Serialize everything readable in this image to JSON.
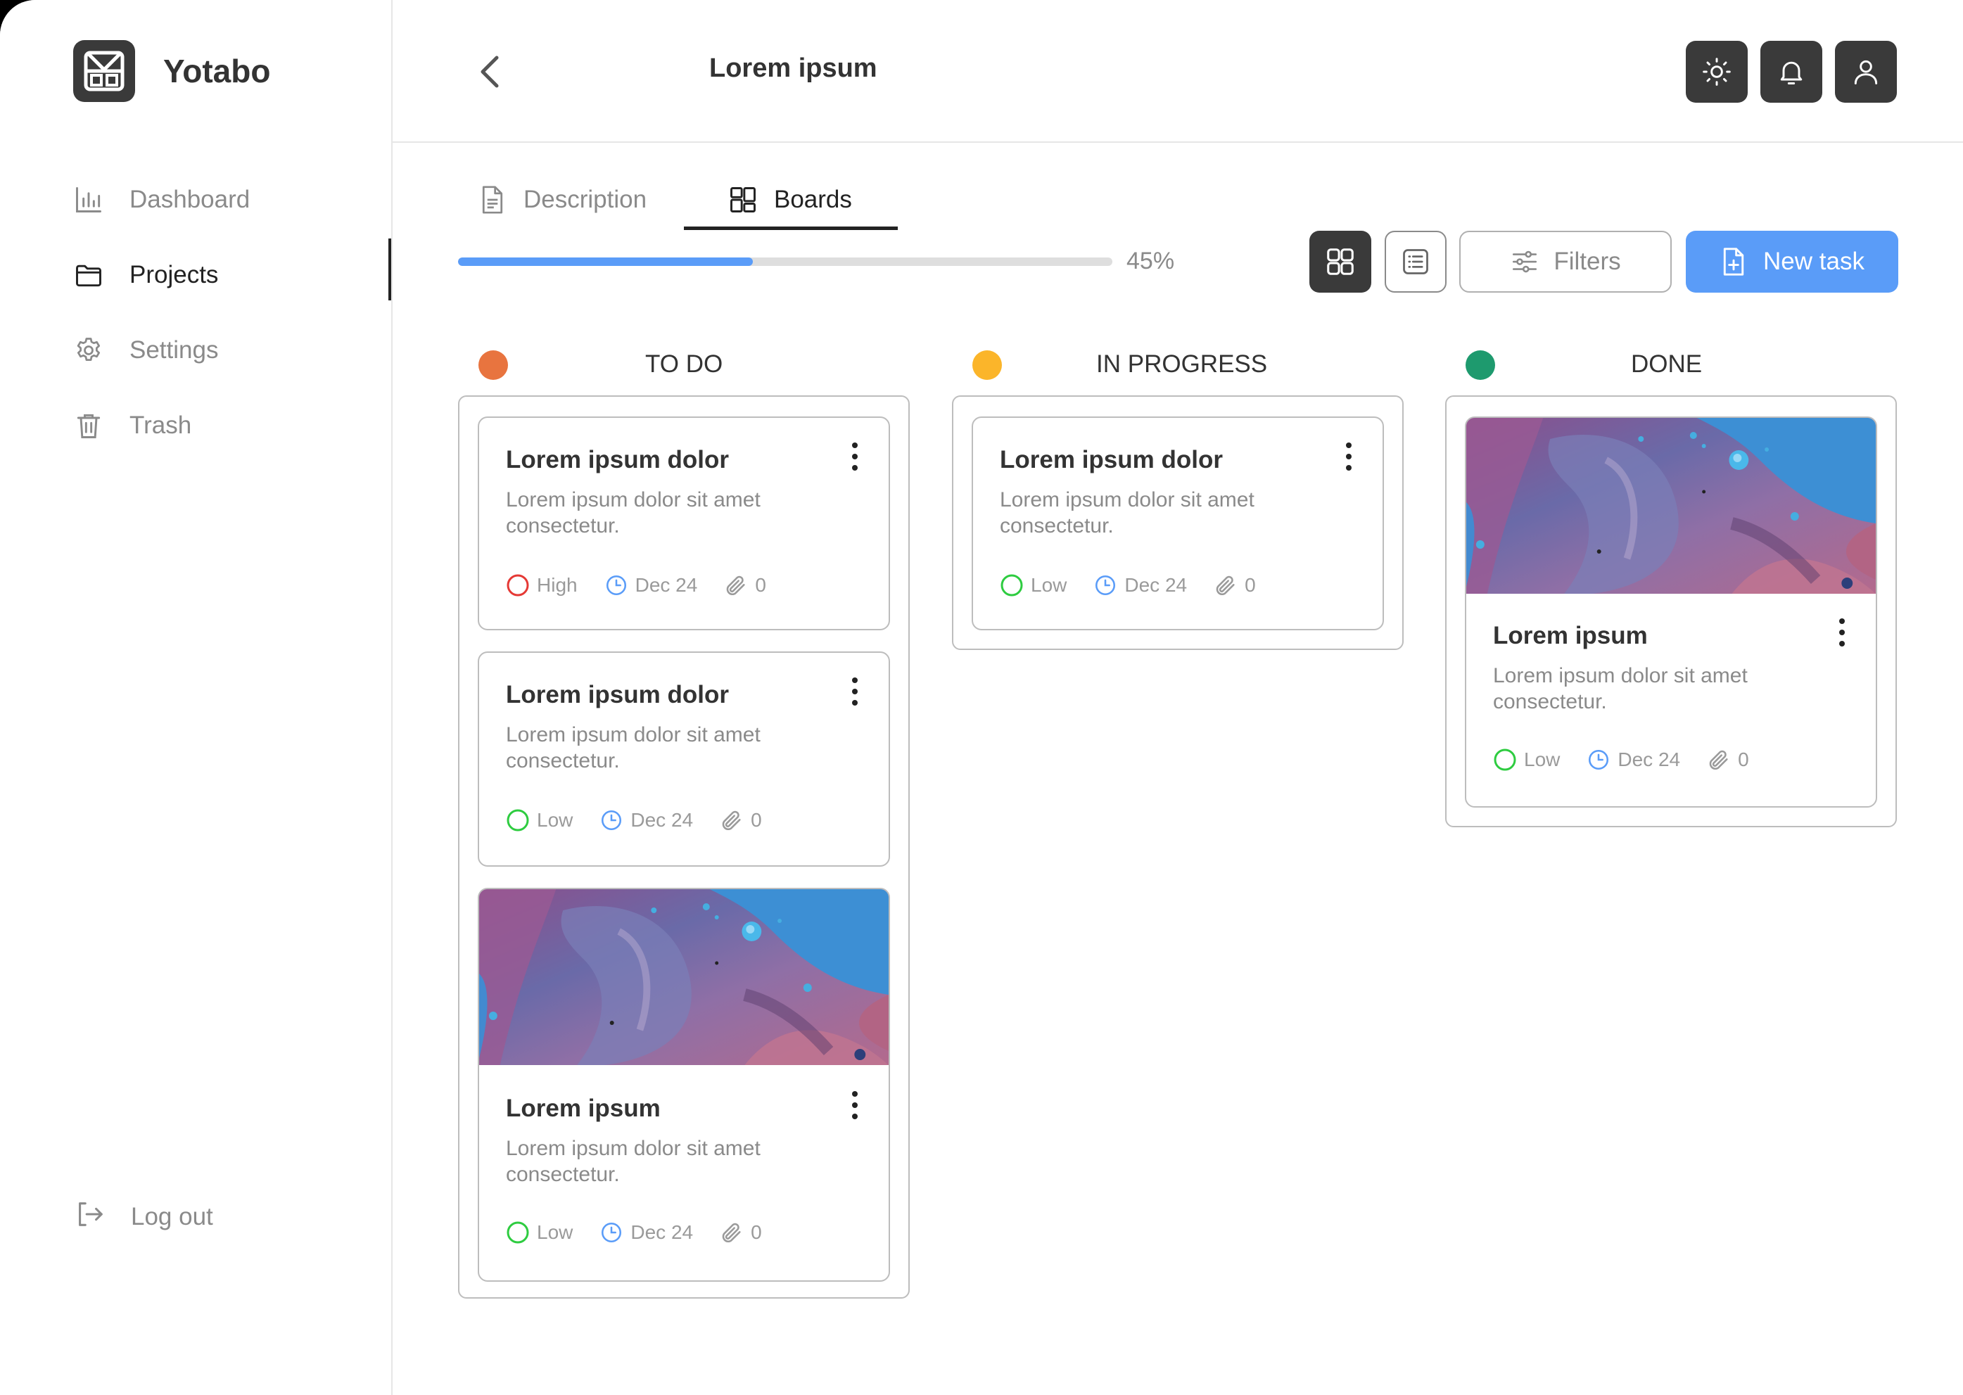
{
  "app": {
    "name": "Yotabo"
  },
  "sidebar": {
    "items": [
      {
        "label": "Dashboard",
        "icon": "bar-chart-icon",
        "active": false
      },
      {
        "label": "Projects",
        "icon": "folder-icon",
        "active": true
      },
      {
        "label": "Settings",
        "icon": "gear-icon",
        "active": false
      },
      {
        "label": "Trash",
        "icon": "trash-icon",
        "active": false
      }
    ],
    "logout": "Log out"
  },
  "header": {
    "title": "Lorem ipsum"
  },
  "tabs": [
    {
      "label": "Description",
      "icon": "document-icon",
      "active": false
    },
    {
      "label": "Boards",
      "icon": "boards-icon",
      "active": true
    }
  ],
  "progress": {
    "percent": 45,
    "label": "45%"
  },
  "toolbar": {
    "filters": "Filters",
    "new_task": "New task"
  },
  "colors": {
    "accent": "#5a9cf8",
    "dark": "#3a3a3a",
    "todo": "#e8743f",
    "in_progress": "#fbb52a",
    "done": "#1e9a6e",
    "high": "#e53935",
    "low": "#2ecc40",
    "date": "#5a9cf8"
  },
  "columns": [
    {
      "title": "TO DO",
      "cards": [
        {
          "title": "Lorem ipsum dolor",
          "desc": "Lorem ipsum dolor sit amet consectetur.",
          "priority": "High",
          "date": "Dec 24",
          "attachments": "0",
          "image": false
        },
        {
          "title": "Lorem ipsum dolor",
          "desc": "Lorem ipsum dolor sit amet consectetur.",
          "priority": "Low",
          "date": "Dec 24",
          "attachments": "0",
          "image": false
        },
        {
          "title": "Lorem ipsum",
          "desc": "Lorem ipsum dolor sit amet consectetur.",
          "priority": "Low",
          "date": "Dec 24",
          "attachments": "0",
          "image": true
        }
      ]
    },
    {
      "title": "IN PROGRESS",
      "cards": [
        {
          "title": "Lorem ipsum dolor",
          "desc": "Lorem ipsum dolor sit amet consectetur.",
          "priority": "Low",
          "date": "Dec 24",
          "attachments": "0",
          "image": false
        }
      ]
    },
    {
      "title": "DONE",
      "cards": [
        {
          "title": "Lorem ipsum",
          "desc": "Lorem ipsum dolor sit amet consectetur.",
          "priority": "Low",
          "date": "Dec 24",
          "attachments": "0",
          "image": true
        }
      ]
    }
  ]
}
